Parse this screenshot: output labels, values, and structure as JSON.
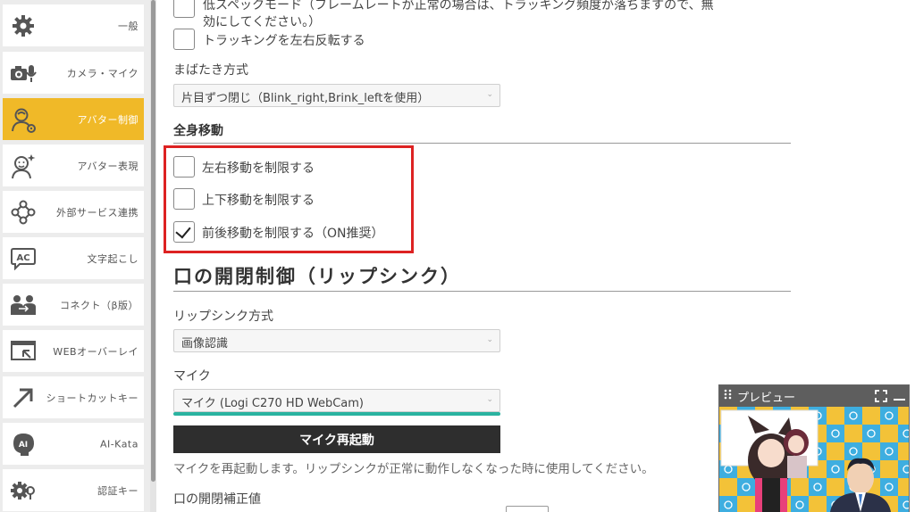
{
  "sidebar": {
    "items": [
      {
        "label": "一般",
        "icon": "gear-icon",
        "active": false
      },
      {
        "label": "カメラ・マイク",
        "icon": "camera-mic-icon",
        "active": false
      },
      {
        "label": "アバター制御",
        "icon": "avatar-control-icon",
        "active": true
      },
      {
        "label": "アバター表現",
        "icon": "avatar-expression-icon",
        "active": false
      },
      {
        "label": "外部サービス連携",
        "icon": "network-icon",
        "active": false
      },
      {
        "label": "文字起こし",
        "icon": "ac-caption-icon",
        "active": false
      },
      {
        "label": "コネクト（β版）",
        "icon": "people-icon",
        "active": false
      },
      {
        "label": "WEBオーバーレイ",
        "icon": "overlay-icon",
        "active": false
      },
      {
        "label": "ショートカットキー",
        "icon": "arrow-icon",
        "active": false
      },
      {
        "label": "AI-Kata",
        "icon": "ai-icon",
        "active": false
      },
      {
        "label": "認証キー",
        "icon": "key-gear-icon",
        "active": false
      }
    ],
    "accent": "#f0b928"
  },
  "main": {
    "low_spec_line1": "低スペックモード（フレームレートが正常の場合は、トラッキング頻度が落ちますので、無",
    "low_spec_line2": "効にしてください。）",
    "flip_tracking": "トラッキングを左右反転する",
    "blink_label": "まばたき方式",
    "blink_value": "片目ずつ閉じ（Blink_right,Brink_leftを使用）",
    "body_move_heading": "全身移動",
    "limit_lr": "左右移動を制限する",
    "limit_ud": "上下移動を制限する",
    "limit_fb": "前後移動を制限する（ON推奨）",
    "limit_fb_checked": true,
    "lipsync_heading": "口の開閉制御（リップシンク）",
    "lipsync_method_label": "リップシンク方式",
    "lipsync_method_value": "画像認識",
    "mic_label": "マイク",
    "mic_value": "マイク (Logi C270 HD WebCam)",
    "mic_restart_button": "マイク再起動",
    "mic_restart_note": "マイクを再起動します。リップシンクが正常に動作しなくなった時に使用してください。",
    "mouth_correction_label": "口の開閉補正値",
    "highlight_color": "#dd2222",
    "mic_level_color": "#2ab3a0"
  },
  "preview": {
    "title": "プレビュー",
    "grip_icon": "drag-grip-icon",
    "expand_icon": "expand-icon",
    "minimize_icon": "minimize-icon"
  }
}
